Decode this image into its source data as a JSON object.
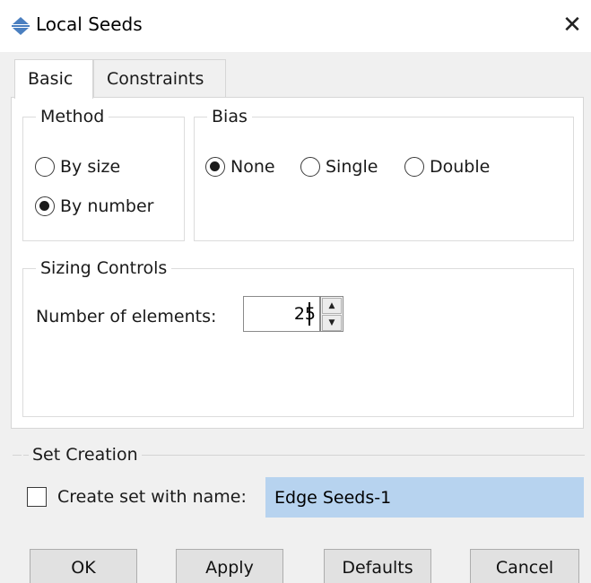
{
  "window": {
    "title": "Local Seeds",
    "icon": "seed-double-arrow-icon",
    "close_glyph": "✕"
  },
  "tabs": [
    {
      "label": "Basic",
      "active": true
    },
    {
      "label": "Constraints",
      "active": false
    }
  ],
  "method": {
    "legend": "Method",
    "options": [
      {
        "label": "By size",
        "checked": false
      },
      {
        "label": "By number",
        "checked": true
      }
    ]
  },
  "bias": {
    "legend": "Bias",
    "options": [
      {
        "label": "None",
        "checked": true
      },
      {
        "label": "Single",
        "checked": false
      },
      {
        "label": "Double",
        "checked": false
      }
    ]
  },
  "sizing": {
    "legend": "Sizing Controls",
    "number_label": "Number of elements:",
    "number_value": "25"
  },
  "set_creation": {
    "legend": "Set Creation",
    "checkbox_label": "Create set with name:",
    "checked": false,
    "name_value": "Edge Seeds-1"
  },
  "buttons": {
    "ok": "OK",
    "apply": "Apply",
    "defaults": "Defaults",
    "cancel": "Cancel"
  },
  "colors": {
    "selection_highlight": "#b7d3ef",
    "dialog_bg": "#f0f0f0"
  }
}
